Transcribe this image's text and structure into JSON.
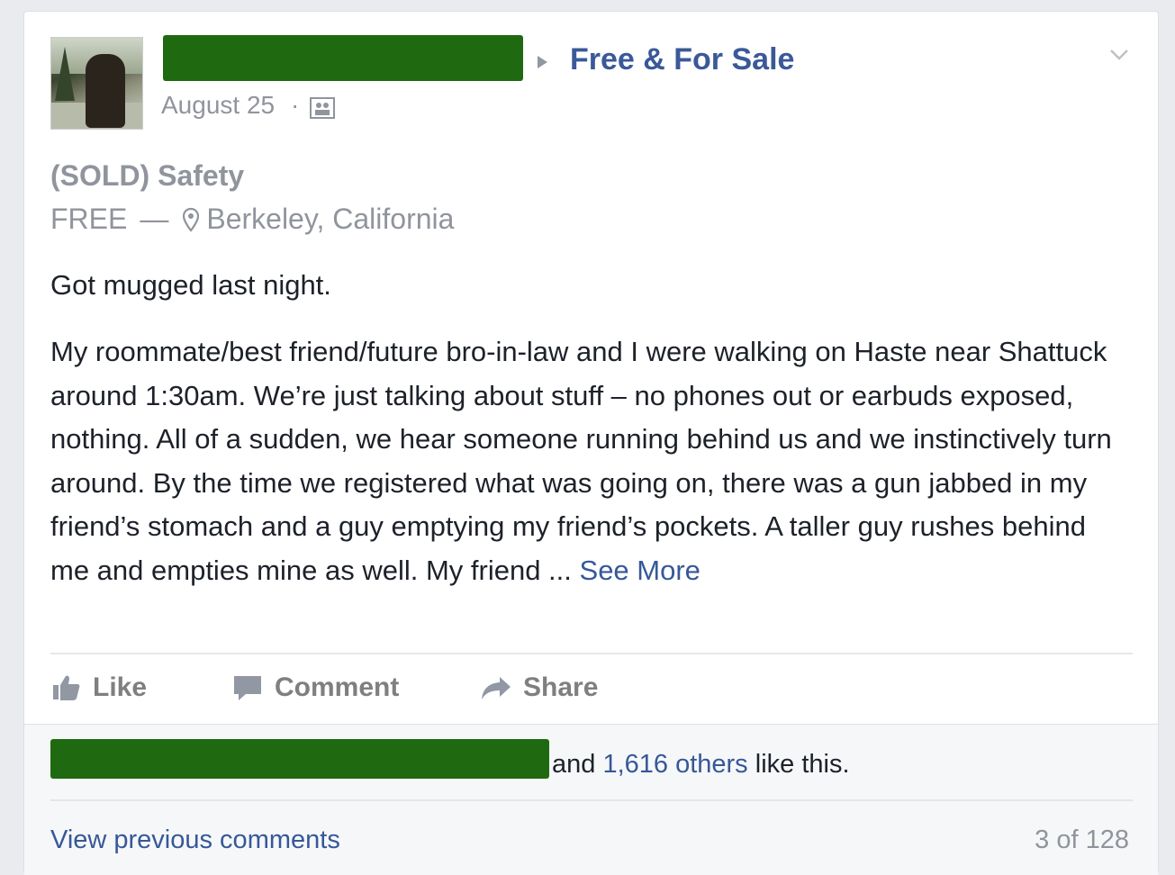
{
  "post": {
    "group_name": "Free & For Sale",
    "date": "August 25",
    "date_separator": "·",
    "title": "(SOLD) Safety",
    "price": "FREE",
    "price_dash": "—",
    "location": "Berkeley, California",
    "first_line": "Got mugged last night.",
    "body": "My roommate/best friend/future bro-in-law and I were walking on Haste near Shattuck around 1:30am. We’re just talking about stuff – no phones out or earbuds exposed, nothing. All of a sudden, we hear someone running behind us and we instinctively turn around. By the time we registered what was going on, there was a gun jabbed in my friend’s stomach and a guy emptying my friend’s pockets. A taller guy rushes behind me and empties mine as well. My friend ...",
    "see_more": "See More"
  },
  "actions": {
    "like": "Like",
    "comment": "Comment",
    "share": "Share"
  },
  "likes": {
    "prefix": "and",
    "others": "1,616 others",
    "suffix": "like this."
  },
  "comments": {
    "view_previous": "View previous comments",
    "pager": "3 of 128"
  },
  "colors": {
    "link": "#3b5998",
    "muted": "#90949c",
    "redaction": "#1f6a10"
  },
  "icons": [
    "avatar",
    "triangle-arrow-icon",
    "chevron-down-icon",
    "privacy-icon",
    "location-pin-icon",
    "thumbs-up-icon",
    "comment-icon",
    "share-arrow-icon"
  ]
}
